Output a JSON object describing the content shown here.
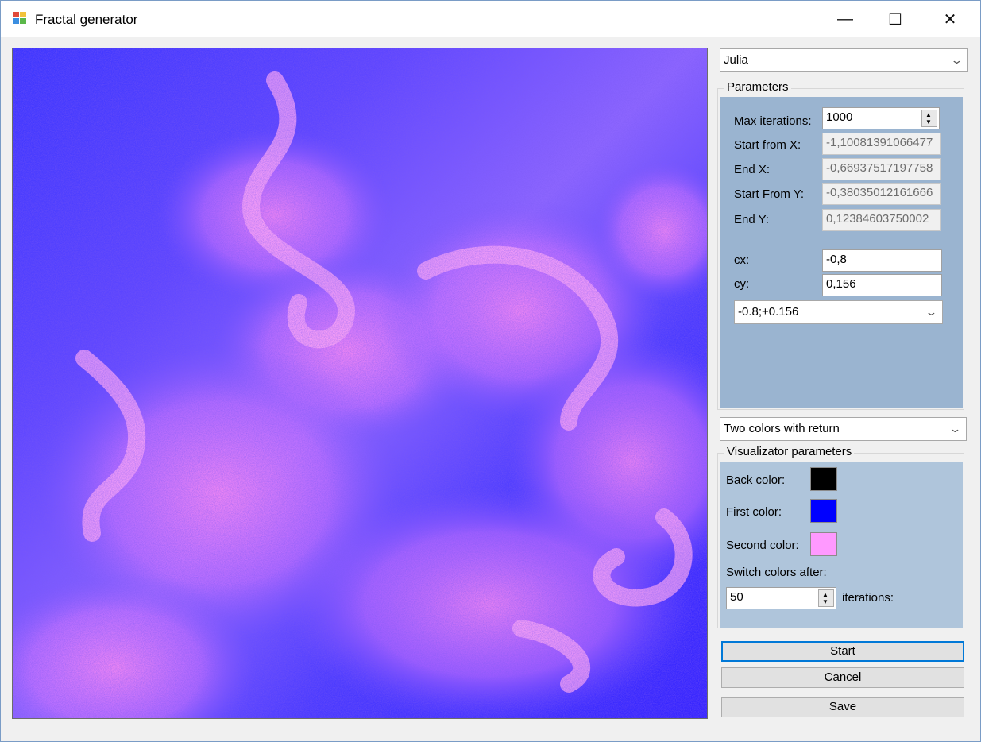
{
  "window": {
    "title": "Fractal generator",
    "controls": {
      "minimize": "—",
      "maximize": "☐",
      "close": "✕"
    },
    "icon": "app-icon"
  },
  "fractal_type": {
    "selected": "Julia"
  },
  "parameters": {
    "group_label": "Parameters",
    "max_iterations": {
      "label": "Max iterations:",
      "value": "1000"
    },
    "start_x": {
      "label": "Start from X:",
      "value": "-1,10081391066477"
    },
    "end_x": {
      "label": "End X:",
      "value": "-0,66937517197758"
    },
    "start_y": {
      "label": "Start From Y:",
      "value": "-0,38035012161666"
    },
    "end_y": {
      "label": "End Y:",
      "value": "0,12384603750002"
    },
    "cx": {
      "label": "cx:",
      "value": "-0,8"
    },
    "cy": {
      "label": "cy:",
      "value": "0,156"
    },
    "preset": {
      "selected": "-0.8;+0.156"
    }
  },
  "visualizer": {
    "selected": "Two colors with return",
    "group_label": "Visualizator parameters",
    "back_color": {
      "label": "Back color:",
      "color": "#000000"
    },
    "first_color": {
      "label": "First color:",
      "color": "#0000ff"
    },
    "second_color": {
      "label": "Second color:",
      "color": "#ff99ff"
    },
    "switch_label": "Switch colors after:",
    "switch_value": "50",
    "iterations_label": "iterations:"
  },
  "buttons": {
    "start": "Start",
    "cancel": "Cancel",
    "save": "Save"
  },
  "colors": {
    "accent": "#0078d7",
    "panel_params": "#9ab4d0",
    "panel_viz": "#afc5db"
  }
}
